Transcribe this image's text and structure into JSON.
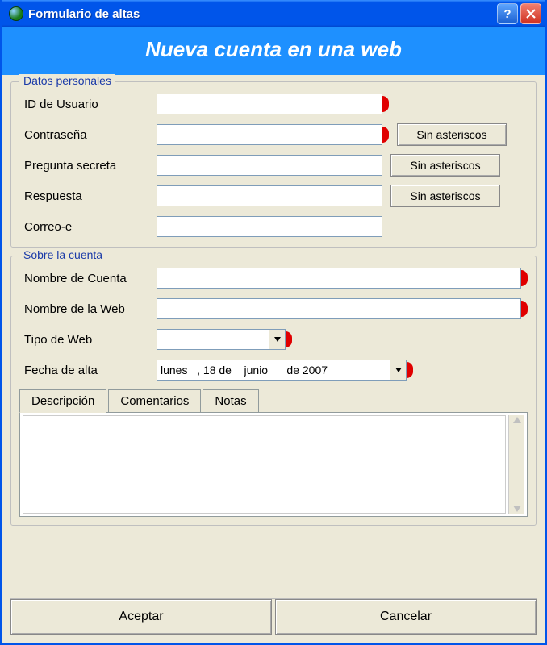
{
  "window": {
    "title": "Formulario de altas"
  },
  "header": {
    "title": "Nueva cuenta en una web"
  },
  "group1": {
    "title": "Datos personales",
    "labels": {
      "user_id": "ID de Usuario",
      "password": "Contraseña",
      "secret_q": "Pregunta secreta",
      "answer": "Respuesta",
      "email": "Correo-e"
    },
    "values": {
      "user_id": "",
      "password": "",
      "secret_q": "",
      "answer": "",
      "email": ""
    },
    "no_asterisks": "Sin asteriscos"
  },
  "group2": {
    "title": "Sobre la cuenta",
    "labels": {
      "account_name": "Nombre de Cuenta",
      "web_name": "Nombre de la Web",
      "web_type": "Tipo de Web",
      "reg_date": "Fecha de alta"
    },
    "values": {
      "account_name": "",
      "web_name": "",
      "web_type": "",
      "reg_date": "lunes   , 18 de    junio      de 2007"
    }
  },
  "tabs": {
    "t1": "Descripción",
    "t2": "Comentarios",
    "t3": "Notas"
  },
  "footer": {
    "ok": "Aceptar",
    "cancel": "Cancelar"
  }
}
